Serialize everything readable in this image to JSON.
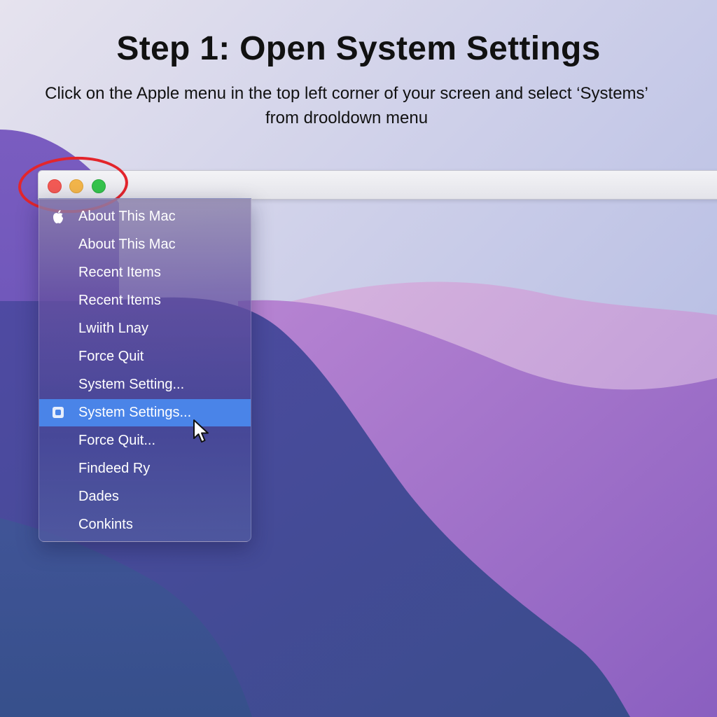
{
  "tutorial": {
    "title": "Step 1: Open System Settings",
    "instruction": "Click on the Apple menu in the top left corner of your screen and select ‘Systems’ from drooldown menu"
  },
  "window": {
    "controls": [
      "close",
      "minimize",
      "zoom"
    ]
  },
  "apple_menu": {
    "items": [
      {
        "label": "About This Mac",
        "icon": "apple-icon"
      },
      {
        "label": "About This Mac"
      },
      {
        "label": "Recent Items"
      },
      {
        "label": "Recent Items"
      },
      {
        "label": "Lwiith Lnay"
      },
      {
        "label": "Force Quit"
      },
      {
        "label": "System Setting..."
      },
      {
        "label": "System Settings...",
        "icon": "settings-icon",
        "selected": true
      },
      {
        "label": "Force Quit..."
      },
      {
        "label": "Findeed Ry"
      },
      {
        "label": "Dades"
      },
      {
        "label": "Conkints"
      }
    ]
  },
  "colors": {
    "highlight_ring": "#e3252c",
    "selected_item": "#4a84e8",
    "close": "#f25a55",
    "minimize": "#f2b54a",
    "zoom": "#35c34c"
  }
}
